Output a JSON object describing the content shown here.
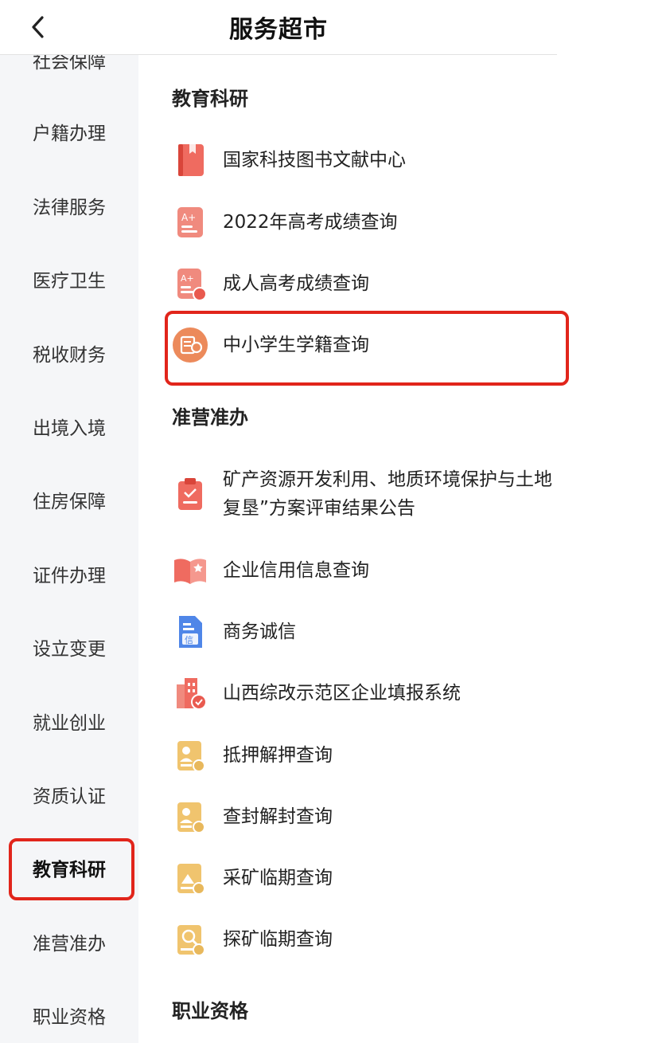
{
  "header": {
    "title": "服务超市",
    "back_icon": "chevron-left-icon"
  },
  "sidebar": {
    "items": [
      {
        "label": "社会保障"
      },
      {
        "label": "户籍办理"
      },
      {
        "label": "法律服务"
      },
      {
        "label": "医疗卫生"
      },
      {
        "label": "税收财务"
      },
      {
        "label": "出境入境"
      },
      {
        "label": "住房保障"
      },
      {
        "label": "证件办理"
      },
      {
        "label": "设立变更"
      },
      {
        "label": "就业创业"
      },
      {
        "label": "资质认证"
      },
      {
        "label": "教育科研",
        "active": true
      },
      {
        "label": "准营准办"
      },
      {
        "label": "职业资格"
      }
    ],
    "highlight_color": "#e1251b"
  },
  "sections": [
    {
      "title": "教育科研",
      "items": [
        {
          "label": "国家科技图书文献中心",
          "icon": "book-icon"
        },
        {
          "label": "2022年高考成绩查询",
          "icon": "exam-score-icon"
        },
        {
          "label": "成人高考成绩查询",
          "icon": "adult-exam-icon"
        },
        {
          "label": "中小学生学籍查询",
          "icon": "student-record-icon",
          "highlighted": true
        }
      ]
    },
    {
      "title": "准营准办",
      "items": [
        {
          "label": "矿产资源开发利用、地质环境保护与土地复垦”方案评审结果公告",
          "icon": "clipboard-icon"
        },
        {
          "label": "企业信用信息查询",
          "icon": "open-book-icon"
        },
        {
          "label": "商务诚信",
          "icon": "credit-document-icon"
        },
        {
          "label": "山西综改示范区企业填报系统",
          "icon": "building-icon"
        },
        {
          "label": "抵押解押查询",
          "icon": "mortgage-icon"
        },
        {
          "label": "查封解封查询",
          "icon": "seal-icon"
        },
        {
          "label": "采矿临期查询",
          "icon": "mining-icon"
        },
        {
          "label": "探矿临期查询",
          "icon": "exploration-icon"
        }
      ]
    },
    {
      "title": "职业资格",
      "items": []
    }
  ],
  "colors": {
    "accent_red": "#e1251b",
    "icon_red": "#ee6a5f",
    "icon_gold": "#e8b85c",
    "icon_blue": "#4f86e8"
  }
}
